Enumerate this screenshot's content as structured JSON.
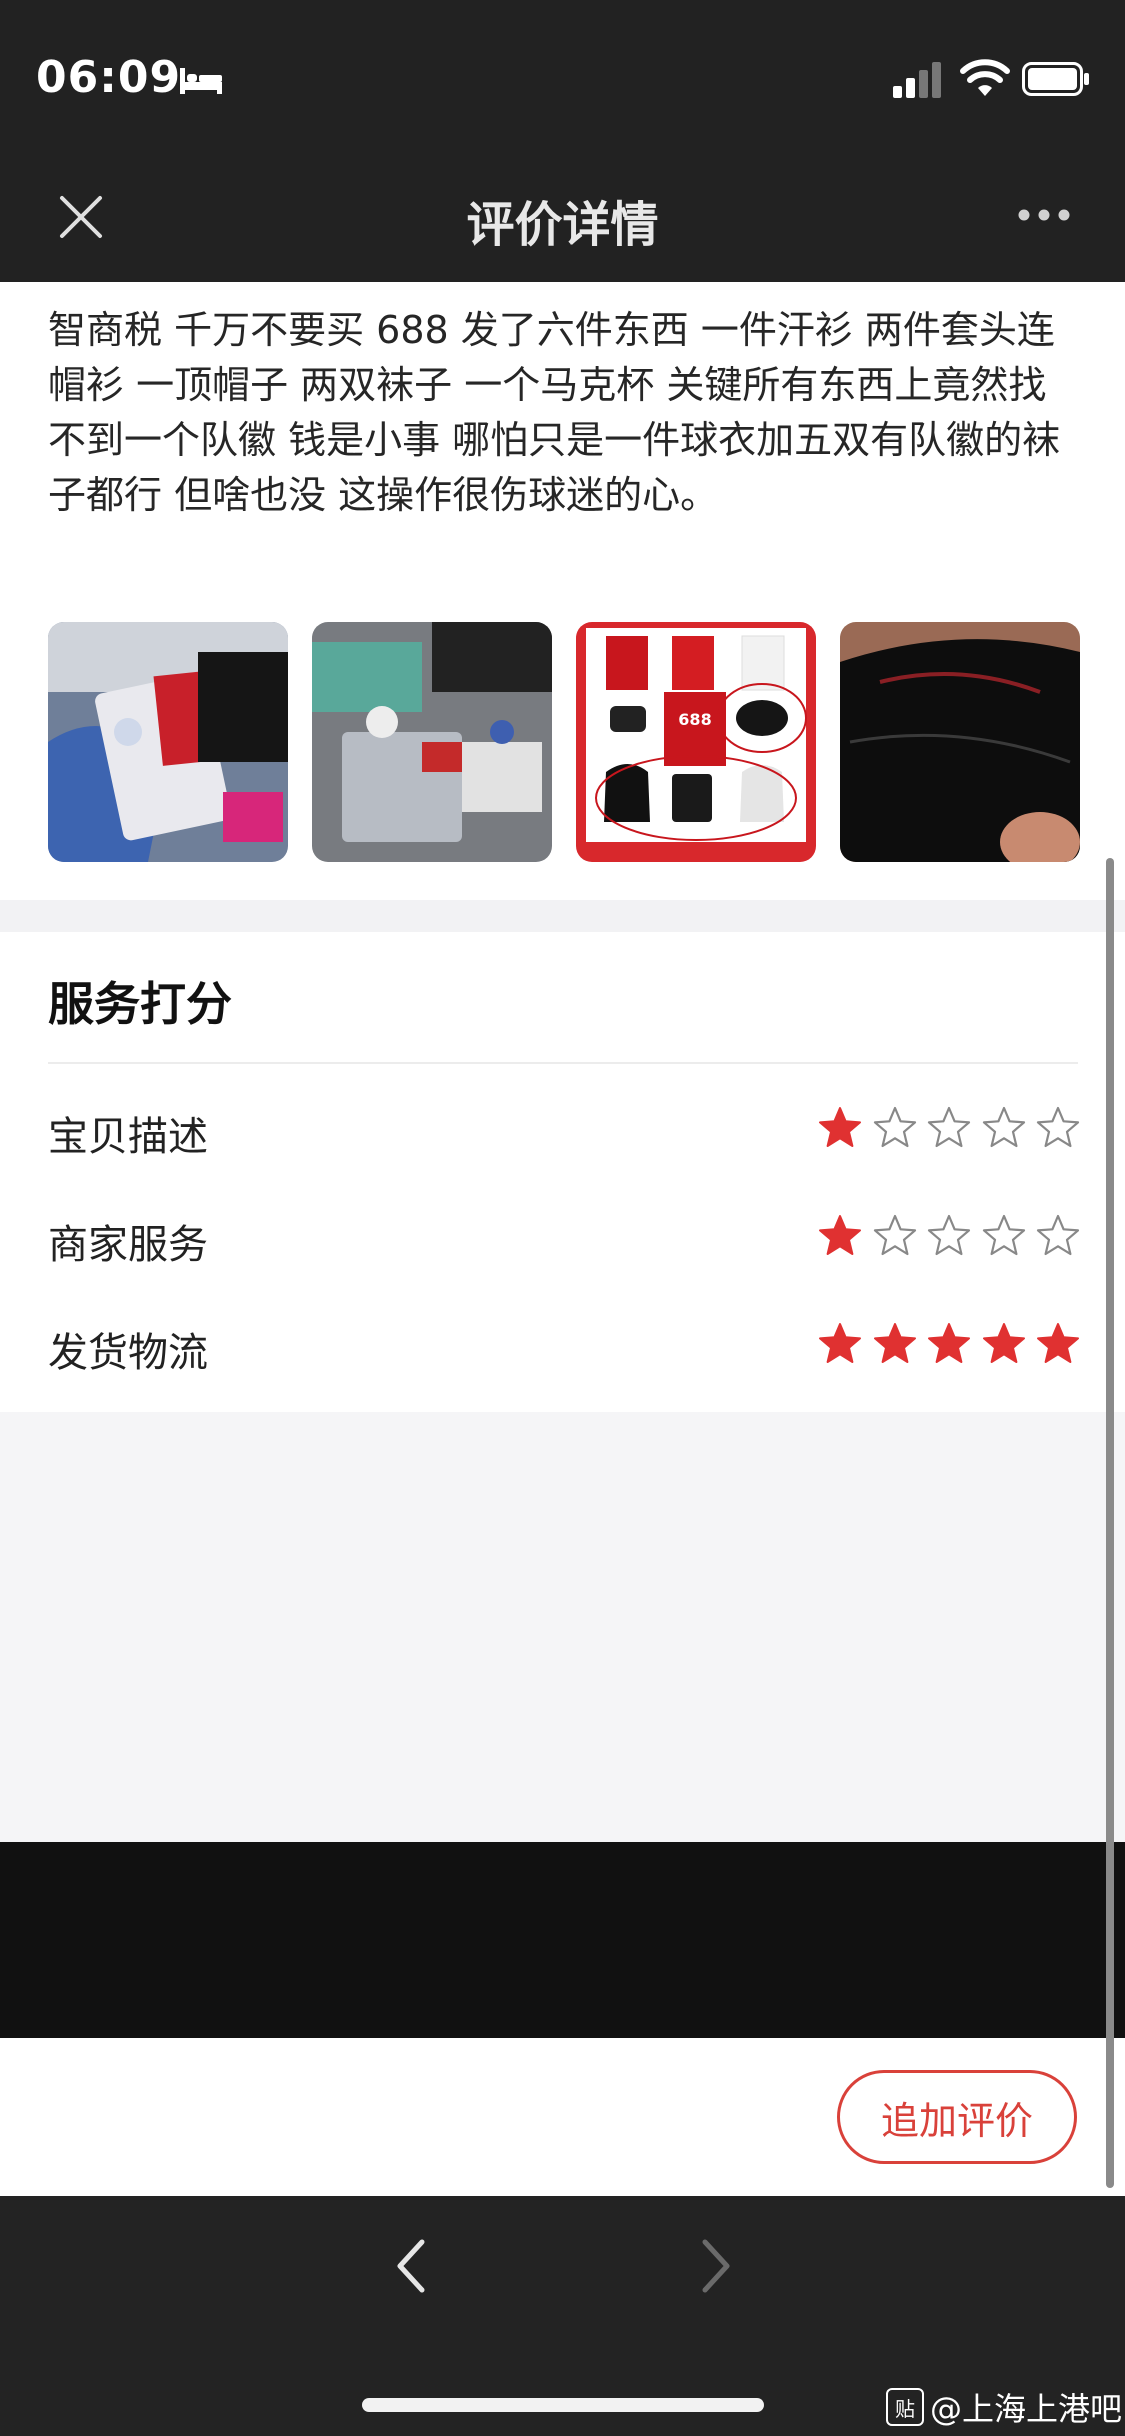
{
  "status_bar": {
    "time": "06:09"
  },
  "nav": {
    "title": "评价详情",
    "close_icon": "close-icon",
    "more_icon": "more-dots-icon"
  },
  "review": {
    "text": "智商税 千万不要买 688 发了六件东西 一件汗衫 两件套头连帽衫 一顶帽子 两双袜子 一个马克杯 关键所有东西上竟然找不到一个队徽 钱是小事 哪怕只是一件球衣加五双有队徽的袜子都行 但啥也没 这操作很伤球迷的心。",
    "photo_texts": {
      "price_tag": "688"
    }
  },
  "service_rating": {
    "title": "服务打分",
    "items": [
      {
        "label": "宝贝描述",
        "stars": 1,
        "max": 5
      },
      {
        "label": "商家服务",
        "stars": 1,
        "max": 5
      },
      {
        "label": "发货物流",
        "stars": 5,
        "max": 5
      }
    ]
  },
  "actions": {
    "add_review": "追加评价"
  },
  "watermark": {
    "badge": "贴",
    "text": "@上海上港吧"
  },
  "colors": {
    "accent": "#d9413a",
    "star_filled": "#e03131",
    "star_empty": "#888888"
  }
}
